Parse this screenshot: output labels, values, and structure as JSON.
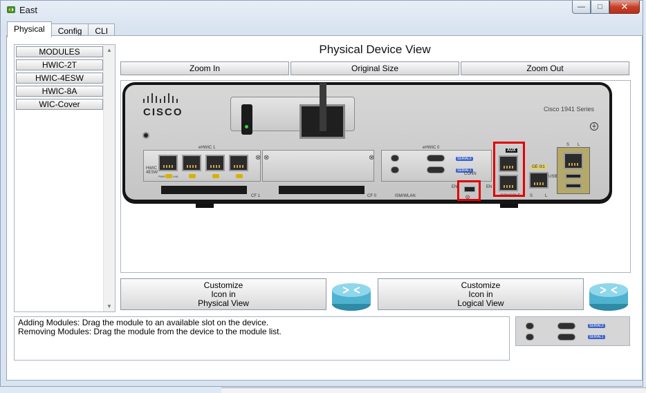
{
  "window": {
    "title": "East"
  },
  "tabs": [
    {
      "label": "Physical",
      "active": true
    },
    {
      "label": "Config",
      "active": false
    },
    {
      "label": "CLI",
      "active": false
    }
  ],
  "modules": {
    "header": "MODULES",
    "items": [
      "HWIC-2T",
      "HWIC-4ESW",
      "HWIC-8A",
      "WIC-Cover"
    ]
  },
  "view": {
    "title": "Physical Device View",
    "zoom_in": "Zoom In",
    "original_size": "Original Size",
    "zoom_out": "Zoom Out"
  },
  "router": {
    "brand": "CISCO",
    "model": "Cisco 1941 Series",
    "ehwic1": "eHWIC 1",
    "ehwic0": "eHWIC 0",
    "cf1": "CF 1",
    "cf0": "CF 0",
    "ism": "ISM/WLAN",
    "aux": "AUX",
    "console": "CONSOLE",
    "ge01": "GE 0/1",
    "serial0": "SERIAL0",
    "serial1": "SERIAL1",
    "en1": "EN",
    "en2": "EN",
    "conn": "CONN",
    "usb": "USB",
    "s_label": "S",
    "l_label": "L",
    "hwic_label": "HWIC 4ESW",
    "led_labels": [
      "PWR",
      "LNK"
    ]
  },
  "customize": {
    "physical_label": "Customize\nIcon in\nPhysical View",
    "logical_label": "Customize\nIcon in\nLogical View"
  },
  "info": {
    "line1": "Adding Modules: Drag the module to an available slot on the device.",
    "line2": "Removing Modules: Drag the module from the device to the module list."
  },
  "colors": {
    "highlight": "#e00000",
    "window_bg": "#d9e4f1"
  }
}
